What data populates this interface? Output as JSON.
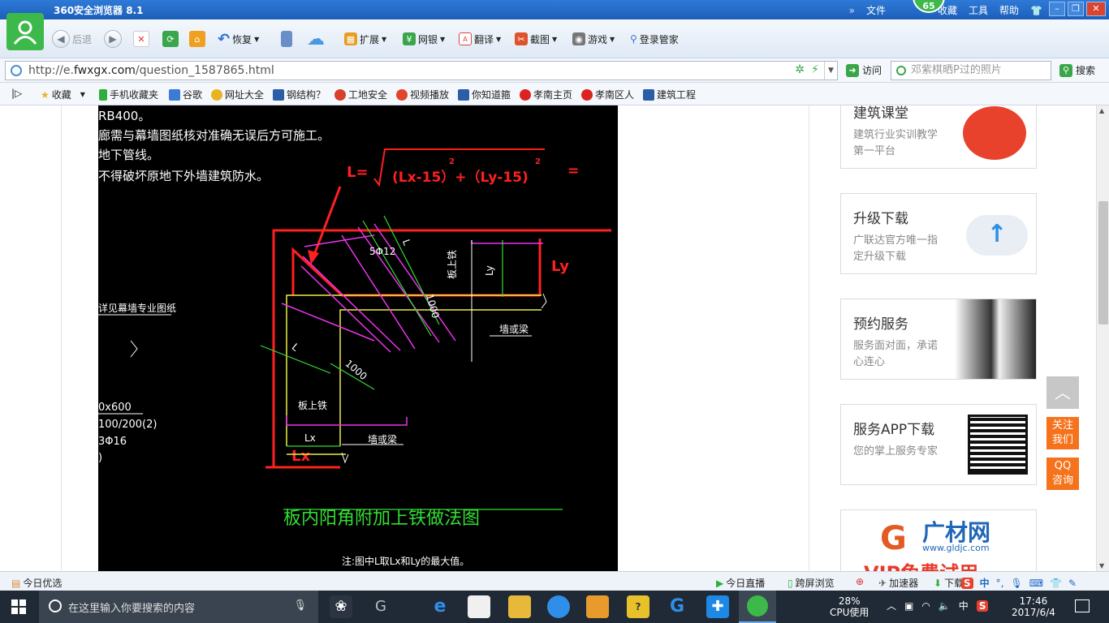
{
  "browser": {
    "title": "360安全浏览器 8.1",
    "title_right": [
      "文件",
      "收藏",
      "工具",
      "帮助"
    ],
    "badge": "65"
  },
  "toolbar": {
    "back": "后退",
    "restore": "恢复",
    "items": [
      "扩展",
      "网银",
      "翻译",
      "截图",
      "游戏",
      "登录管家"
    ]
  },
  "address": {
    "protocol": "http://e.",
    "domain": "fwxgx.com",
    "path": "/question_1587865.html",
    "visit": "访问",
    "search_placeholder": "邓紫棋晒P过的照片",
    "search_button": "搜索"
  },
  "favorites": [
    "收藏",
    "手机收藏夹",
    "谷歌",
    "网址大全",
    "钢结构？",
    "工地安全",
    "视频播放",
    "你知道箍",
    "孝南主页",
    "孝南区人",
    "建筑工程"
  ],
  "cad": {
    "notes": [
      "RB400。",
      "廊需与幕墙图纸核对准确无误后方可施工。",
      "地下管线。",
      "不得破坏原地下外墙建筑防水。"
    ],
    "formula_prefix": "L=",
    "formula_body": "(Lx-15）+（Ly-15)",
    "formula_sup": "2",
    "formula_eq": "=",
    "label_ly": "Ly",
    "label_lx": "Lx",
    "left_labels": [
      "详见幕墙专业图纸",
      "0x600",
      "100/200(2)",
      "3Φ16",
      ")"
    ],
    "bar_label": "5Φ12",
    "dim_1000_a": "1000",
    "dim_1000_b": "1000",
    "label_l_top": "L",
    "label_l_left": "L",
    "board_bar_right": "板上铁",
    "ly_small": "Ly",
    "beam_right": "墙或梁",
    "board_bar_bottom": "板上铁",
    "lx_small": "Lx",
    "beam_bottom": "墙或梁",
    "drawing_title": "板内阳角附加上铁做法图",
    "drawing_note": "注:图中L取Lx和Ly的最大值。"
  },
  "sidebar": {
    "cards": [
      {
        "title": "建筑课堂",
        "sub": "建筑行业实训教学第一平台"
      },
      {
        "title": "升级下载",
        "sub": "广联达官方唯一指定升级下载"
      },
      {
        "title": "预约服务",
        "sub": "服务面对面，承诺心连心"
      },
      {
        "title": "服务APP下载",
        "sub": "您的掌上服务专家"
      }
    ],
    "ad_brand": "广材网",
    "ad_url": "www.gldjc.com",
    "ad_vip": "VIP免费试用",
    "follow": "关注我们",
    "qq": "QQ咨询"
  },
  "statusbar": {
    "left": "今日优选",
    "live": "今日直播",
    "crossscreen": "跨屏浏览",
    "accelerator": "加速器",
    "download": "下载",
    "ime": "中"
  },
  "taskbar": {
    "search_placeholder": "在这里输入你要搜索的内容",
    "cpu": "28%",
    "cpu_label": "CPU使用",
    "lang": "中",
    "time": "17:46",
    "date": "2017/6/4"
  },
  "colors": {
    "cad_red": "#ff2020",
    "cad_green": "#33dd33",
    "cad_magenta": "#ee33ee",
    "cad_yellow": "#eeee44",
    "accent_orange": "#f5731d",
    "logo_green": "#3cb94a"
  }
}
